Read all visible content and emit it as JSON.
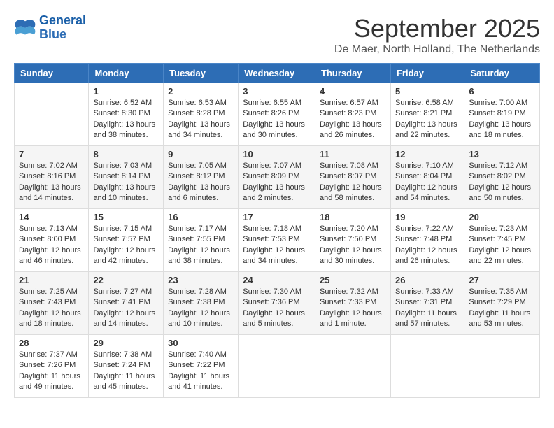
{
  "logo": {
    "text_general": "General",
    "text_blue": "Blue"
  },
  "header": {
    "title": "September 2025",
    "location": "De Maer, North Holland, The Netherlands"
  },
  "weekdays": [
    "Sunday",
    "Monday",
    "Tuesday",
    "Wednesday",
    "Thursday",
    "Friday",
    "Saturday"
  ],
  "weeks": [
    [
      {
        "num": "",
        "sunrise": "",
        "sunset": "",
        "daylight": ""
      },
      {
        "num": "1",
        "sunrise": "Sunrise: 6:52 AM",
        "sunset": "Sunset: 8:30 PM",
        "daylight": "Daylight: 13 hours and 38 minutes."
      },
      {
        "num": "2",
        "sunrise": "Sunrise: 6:53 AM",
        "sunset": "Sunset: 8:28 PM",
        "daylight": "Daylight: 13 hours and 34 minutes."
      },
      {
        "num": "3",
        "sunrise": "Sunrise: 6:55 AM",
        "sunset": "Sunset: 8:26 PM",
        "daylight": "Daylight: 13 hours and 30 minutes."
      },
      {
        "num": "4",
        "sunrise": "Sunrise: 6:57 AM",
        "sunset": "Sunset: 8:23 PM",
        "daylight": "Daylight: 13 hours and 26 minutes."
      },
      {
        "num": "5",
        "sunrise": "Sunrise: 6:58 AM",
        "sunset": "Sunset: 8:21 PM",
        "daylight": "Daylight: 13 hours and 22 minutes."
      },
      {
        "num": "6",
        "sunrise": "Sunrise: 7:00 AM",
        "sunset": "Sunset: 8:19 PM",
        "daylight": "Daylight: 13 hours and 18 minutes."
      }
    ],
    [
      {
        "num": "7",
        "sunrise": "Sunrise: 7:02 AM",
        "sunset": "Sunset: 8:16 PM",
        "daylight": "Daylight: 13 hours and 14 minutes."
      },
      {
        "num": "8",
        "sunrise": "Sunrise: 7:03 AM",
        "sunset": "Sunset: 8:14 PM",
        "daylight": "Daylight: 13 hours and 10 minutes."
      },
      {
        "num": "9",
        "sunrise": "Sunrise: 7:05 AM",
        "sunset": "Sunset: 8:12 PM",
        "daylight": "Daylight: 13 hours and 6 minutes."
      },
      {
        "num": "10",
        "sunrise": "Sunrise: 7:07 AM",
        "sunset": "Sunset: 8:09 PM",
        "daylight": "Daylight: 13 hours and 2 minutes."
      },
      {
        "num": "11",
        "sunrise": "Sunrise: 7:08 AM",
        "sunset": "Sunset: 8:07 PM",
        "daylight": "Daylight: 12 hours and 58 minutes."
      },
      {
        "num": "12",
        "sunrise": "Sunrise: 7:10 AM",
        "sunset": "Sunset: 8:04 PM",
        "daylight": "Daylight: 12 hours and 54 minutes."
      },
      {
        "num": "13",
        "sunrise": "Sunrise: 7:12 AM",
        "sunset": "Sunset: 8:02 PM",
        "daylight": "Daylight: 12 hours and 50 minutes."
      }
    ],
    [
      {
        "num": "14",
        "sunrise": "Sunrise: 7:13 AM",
        "sunset": "Sunset: 8:00 PM",
        "daylight": "Daylight: 12 hours and 46 minutes."
      },
      {
        "num": "15",
        "sunrise": "Sunrise: 7:15 AM",
        "sunset": "Sunset: 7:57 PM",
        "daylight": "Daylight: 12 hours and 42 minutes."
      },
      {
        "num": "16",
        "sunrise": "Sunrise: 7:17 AM",
        "sunset": "Sunset: 7:55 PM",
        "daylight": "Daylight: 12 hours and 38 minutes."
      },
      {
        "num": "17",
        "sunrise": "Sunrise: 7:18 AM",
        "sunset": "Sunset: 7:53 PM",
        "daylight": "Daylight: 12 hours and 34 minutes."
      },
      {
        "num": "18",
        "sunrise": "Sunrise: 7:20 AM",
        "sunset": "Sunset: 7:50 PM",
        "daylight": "Daylight: 12 hours and 30 minutes."
      },
      {
        "num": "19",
        "sunrise": "Sunrise: 7:22 AM",
        "sunset": "Sunset: 7:48 PM",
        "daylight": "Daylight: 12 hours and 26 minutes."
      },
      {
        "num": "20",
        "sunrise": "Sunrise: 7:23 AM",
        "sunset": "Sunset: 7:45 PM",
        "daylight": "Daylight: 12 hours and 22 minutes."
      }
    ],
    [
      {
        "num": "21",
        "sunrise": "Sunrise: 7:25 AM",
        "sunset": "Sunset: 7:43 PM",
        "daylight": "Daylight: 12 hours and 18 minutes."
      },
      {
        "num": "22",
        "sunrise": "Sunrise: 7:27 AM",
        "sunset": "Sunset: 7:41 PM",
        "daylight": "Daylight: 12 hours and 14 minutes."
      },
      {
        "num": "23",
        "sunrise": "Sunrise: 7:28 AM",
        "sunset": "Sunset: 7:38 PM",
        "daylight": "Daylight: 12 hours and 10 minutes."
      },
      {
        "num": "24",
        "sunrise": "Sunrise: 7:30 AM",
        "sunset": "Sunset: 7:36 PM",
        "daylight": "Daylight: 12 hours and 5 minutes."
      },
      {
        "num": "25",
        "sunrise": "Sunrise: 7:32 AM",
        "sunset": "Sunset: 7:33 PM",
        "daylight": "Daylight: 12 hours and 1 minute."
      },
      {
        "num": "26",
        "sunrise": "Sunrise: 7:33 AM",
        "sunset": "Sunset: 7:31 PM",
        "daylight": "Daylight: 11 hours and 57 minutes."
      },
      {
        "num": "27",
        "sunrise": "Sunrise: 7:35 AM",
        "sunset": "Sunset: 7:29 PM",
        "daylight": "Daylight: 11 hours and 53 minutes."
      }
    ],
    [
      {
        "num": "28",
        "sunrise": "Sunrise: 7:37 AM",
        "sunset": "Sunset: 7:26 PM",
        "daylight": "Daylight: 11 hours and 49 minutes."
      },
      {
        "num": "29",
        "sunrise": "Sunrise: 7:38 AM",
        "sunset": "Sunset: 7:24 PM",
        "daylight": "Daylight: 11 hours and 45 minutes."
      },
      {
        "num": "30",
        "sunrise": "Sunrise: 7:40 AM",
        "sunset": "Sunset: 7:22 PM",
        "daylight": "Daylight: 11 hours and 41 minutes."
      },
      {
        "num": "",
        "sunrise": "",
        "sunset": "",
        "daylight": ""
      },
      {
        "num": "",
        "sunrise": "",
        "sunset": "",
        "daylight": ""
      },
      {
        "num": "",
        "sunrise": "",
        "sunset": "",
        "daylight": ""
      },
      {
        "num": "",
        "sunrise": "",
        "sunset": "",
        "daylight": ""
      }
    ]
  ]
}
